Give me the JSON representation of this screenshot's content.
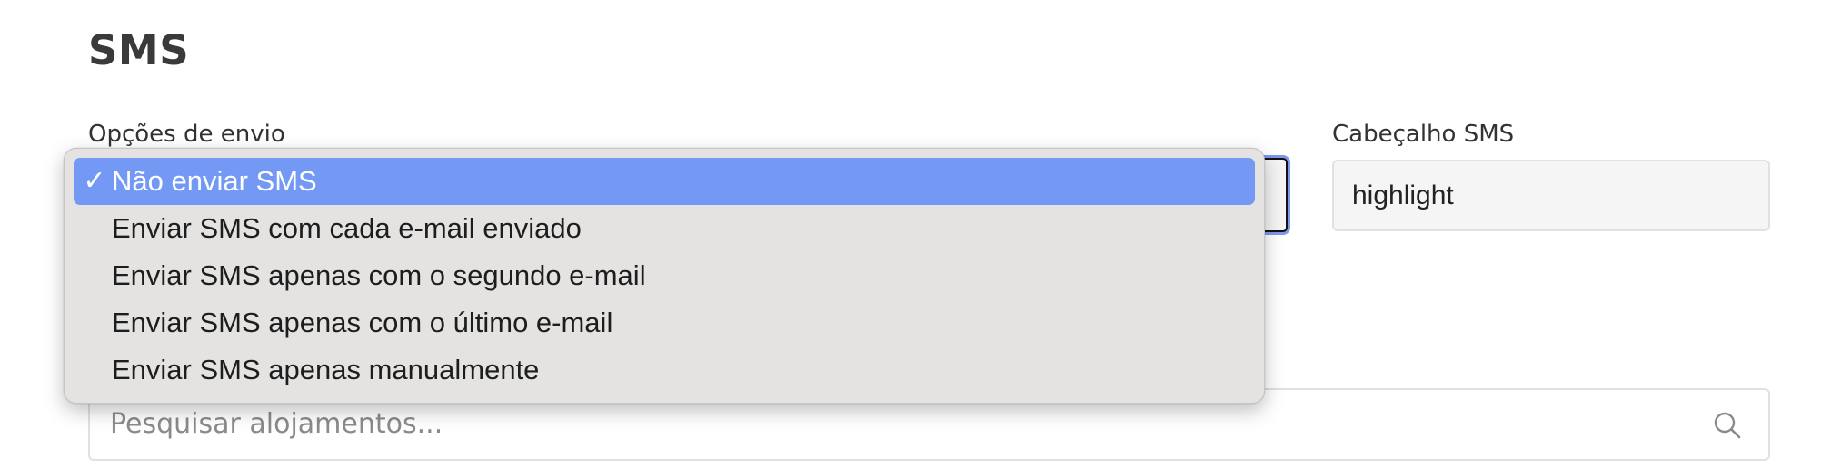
{
  "section": {
    "title": "SMS"
  },
  "send_options": {
    "label": "Opções de envio",
    "selected_value": "Não enviar SMS",
    "options": [
      "Não enviar SMS",
      "Enviar SMS com cada e-mail enviado",
      "Enviar SMS apenas com o segundo e-mail",
      "Enviar SMS apenas com o último e-mail",
      "Enviar SMS apenas manualmente"
    ],
    "check_glyph": "✓"
  },
  "sms_header": {
    "label": "Cabeçalho SMS",
    "value": "highlight"
  },
  "search": {
    "placeholder": "Pesquisar alojamentos...",
    "icon": "search-icon"
  },
  "colors": {
    "selected_highlight": "#7399f5",
    "menu_background": "#e4e3e2",
    "focus_ring": "#7a98f0"
  }
}
